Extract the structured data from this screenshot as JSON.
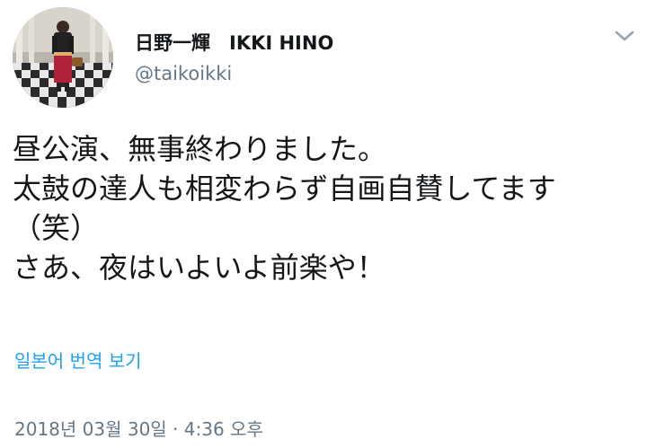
{
  "user": {
    "display_name": "日野一輝　IKKI HINO",
    "handle": "@taikoikki",
    "avatar_icon": "profile-photo"
  },
  "tweet": {
    "lines": [
      "昼公演、無事終わりました。",
      "太鼓の達人も相変わらず自画自賛してます",
      "（笑）",
      "さあ、夜はいよいよ前楽や！"
    ],
    "translate_label": "일본어 번역 보기",
    "timestamp": "2018년 03월 30일 · 4:36 오후"
  },
  "menu": {
    "icon": "chevron-down-icon"
  },
  "colors": {
    "text": "#14171a",
    "secondary": "#657786",
    "link": "#1da1f2"
  }
}
